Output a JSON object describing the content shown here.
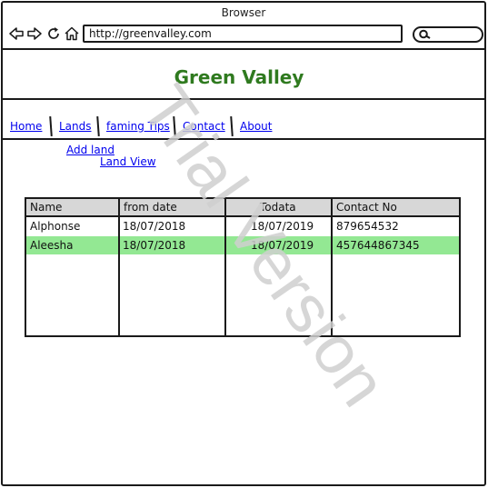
{
  "browser": {
    "title": "Browser",
    "url": "http://greenvalley.com"
  },
  "page": {
    "title": "Green Valley",
    "title_color": "#2f7a1f"
  },
  "menu": {
    "items": [
      "Home",
      "Lands",
      "faming Tips",
      "Contact",
      "About"
    ]
  },
  "submenu": {
    "add_land": "Add land",
    "land_view": "Land View"
  },
  "table": {
    "columns": [
      "Name",
      "from date",
      "Todata",
      "Contact No"
    ],
    "rows": [
      [
        "Alphonse",
        "18/07/2018",
        "18/07/2019",
        "879654532"
      ],
      [
        "Aleesha",
        "18/07/2018",
        "18/07/2019",
        "457644867345"
      ]
    ],
    "selected_row_color": "#93e893"
  },
  "watermark": {
    "text": "Trial Version",
    "color": "#cfcfcf"
  }
}
